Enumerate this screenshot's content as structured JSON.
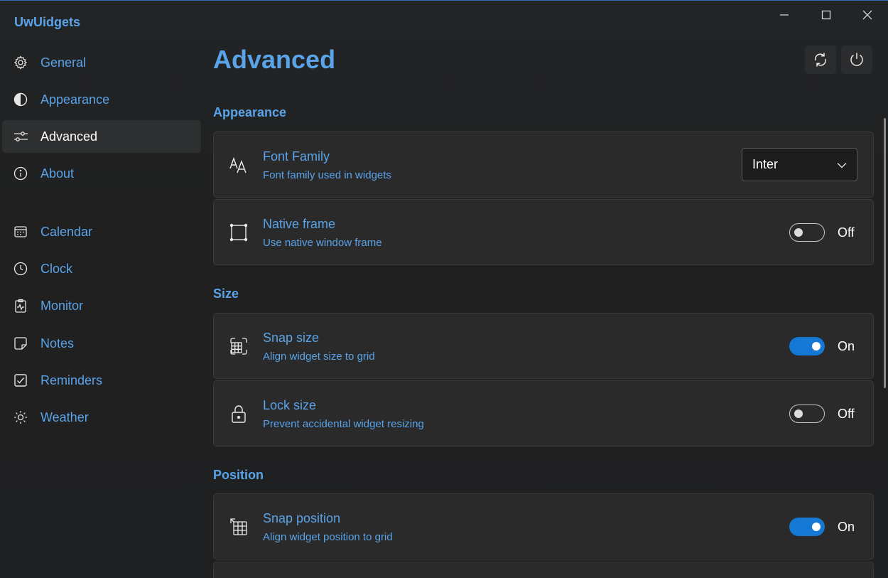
{
  "app": {
    "title": "UwUidgets"
  },
  "sidebar": {
    "items": [
      {
        "label": "General",
        "icon": "gear-icon"
      },
      {
        "label": "Appearance",
        "icon": "contrast-icon"
      },
      {
        "label": "Advanced",
        "icon": "sliders-icon",
        "selected": true
      },
      {
        "label": "About",
        "icon": "info-icon"
      },
      {
        "label": "Calendar",
        "icon": "calendar-icon"
      },
      {
        "label": "Clock",
        "icon": "clock-icon"
      },
      {
        "label": "Monitor",
        "icon": "monitor-icon"
      },
      {
        "label": "Notes",
        "icon": "note-icon"
      },
      {
        "label": "Reminders",
        "icon": "checkbox-icon"
      },
      {
        "label": "Weather",
        "icon": "sun-icon"
      }
    ]
  },
  "page": {
    "title": "Advanced"
  },
  "sections": {
    "appearance": {
      "header": "Appearance",
      "font_family": {
        "title": "Font Family",
        "desc": "Font family used in widgets",
        "value": "Inter"
      },
      "native_frame": {
        "title": "Native frame",
        "desc": "Use native window frame",
        "state": "Off"
      }
    },
    "size": {
      "header": "Size",
      "snap_size": {
        "title": "Snap size",
        "desc": "Align widget size to grid",
        "state": "On"
      },
      "lock_size": {
        "title": "Lock size",
        "desc": "Prevent accidental widget resizing",
        "state": "Off"
      }
    },
    "position": {
      "header": "Position",
      "snap_position": {
        "title": "Snap position",
        "desc": "Align widget position to grid",
        "state": "On"
      }
    }
  },
  "colors": {
    "accent": "#5aa3e8",
    "toggle_on": "#1478d4",
    "background": "#202020",
    "card": "#2a2a2a"
  }
}
